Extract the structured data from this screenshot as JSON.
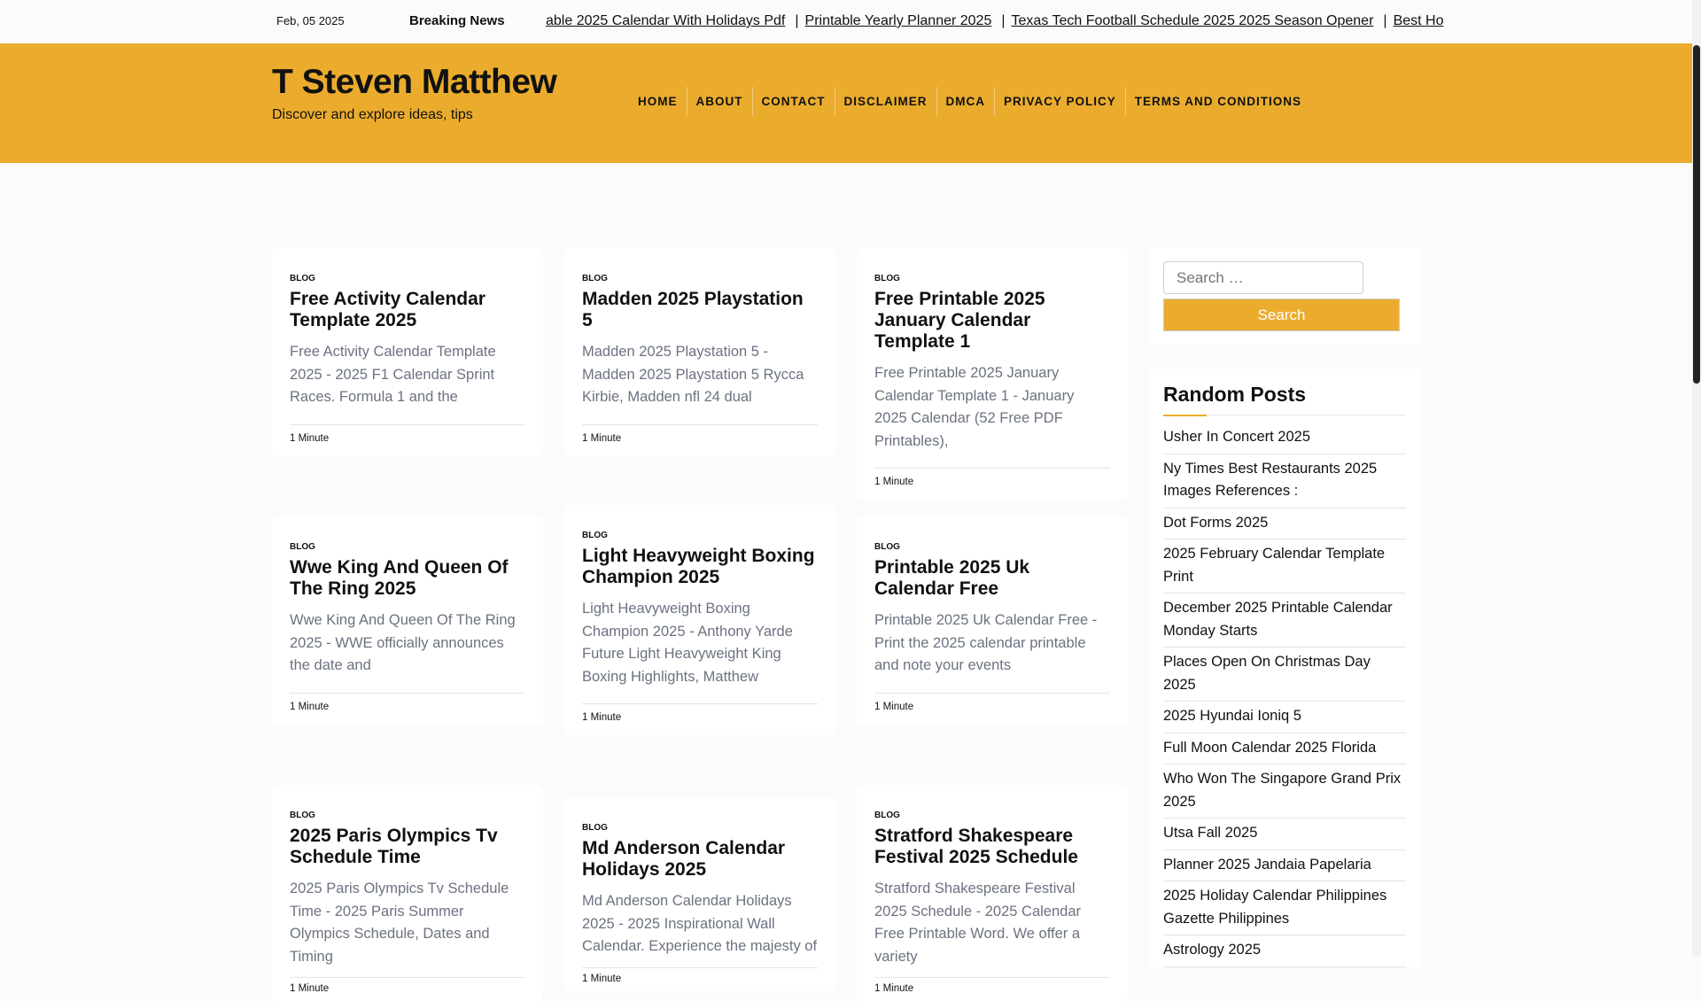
{
  "topbar": {
    "date": "Feb, 05 2025",
    "breaking_label": "Breaking News",
    "ticker": [
      "able 2025 Calendar With Holidays Pdf",
      "Printable Yearly Planner 2025",
      "Texas Tech Football Schedule 2025 2025 Season Opener",
      "Best Ho"
    ]
  },
  "header": {
    "title": "T Steven Matthew",
    "tagline": "Discover and explore ideas, tips",
    "nav": [
      "HOME",
      "ABOUT",
      "CONTACT",
      "DISCLAIMER",
      "DMCA",
      "PRIVACY POLICY",
      "TERMS AND CONDITIONS"
    ]
  },
  "posts": [
    {
      "category": "BLOG",
      "title": "Free Activity Calendar Template 2025",
      "excerpt": "Free Activity Calendar Template 2025 - 2025 F1 Calendar Sprint Races. Formula 1 and the",
      "meta": "1 Minute"
    },
    {
      "category": "BLOG",
      "title": "Madden 2025 Playstation 5",
      "excerpt": "Madden 2025 Playstation 5 - Madden 2025 Playstation 5 Rycca Kirbie, Madden nfl 24 dual",
      "meta": "1 Minute"
    },
    {
      "category": "BLOG",
      "title": "Free Printable 2025 January Calendar Template 1",
      "excerpt": "Free Printable 2025 January Calendar Template 1 - January 2025 Calendar (52 Free PDF Printables),",
      "meta": "1 Minute"
    },
    {
      "category": "BLOG",
      "title": "Wwe King And Queen Of The Ring 2025",
      "excerpt": "Wwe King And Queen Of The Ring 2025 - WWE officially announces the date and",
      "meta": "1 Minute"
    },
    {
      "category": "BLOG",
      "title": "Light Heavyweight Boxing Champion 2025",
      "excerpt": "Light Heavyweight Boxing Champion 2025 - Anthony Yarde Future Light Heavyweight King Boxing Highlights, Matthew",
      "meta": "1 Minute"
    },
    {
      "category": "BLOG",
      "title": "Printable 2025 Uk Calendar Free",
      "excerpt": "Printable 2025 Uk Calendar Free - Print the 2025 calendar printable and note your events",
      "meta": "1 Minute"
    },
    {
      "category": "BLOG",
      "title": "2025 Paris Olympics Tv Schedule Time",
      "excerpt": "2025 Paris Olympics Tv Schedule Time - 2025 Paris Summer Olympics Schedule, Dates and Timing",
      "meta": "1 Minute"
    },
    {
      "category": "BLOG",
      "title": "Md Anderson Calendar Holidays 2025",
      "excerpt": "Md Anderson Calendar Holidays 2025 - 2025 Inspirational Wall Calendar. Experience the majesty of",
      "meta": "1 Minute"
    },
    {
      "category": "BLOG",
      "title": "Stratford Shakespeare Festival 2025 Schedule",
      "excerpt": "Stratford Shakespeare Festival 2025 Schedule - 2025 Calendar Free Printable Word. We offer a variety",
      "meta": "1 Minute"
    }
  ],
  "sidebar": {
    "search_placeholder": "Search …",
    "search_button": "Search",
    "random_title": "Random Posts",
    "random": [
      "Usher In Concert 2025",
      "Ny Times Best Restaurants 2025 Images References :",
      "Dot Forms 2025",
      "2025 February Calendar Template Print",
      "December 2025 Printable Calendar Monday Starts",
      "Places Open On Christmas Day 2025",
      "2025 Hyundai Ioniq 5",
      "Full Moon Calendar 2025 Florida",
      "Who Won The Singapore Grand Prix 2025",
      "Utsa Fall 2025",
      "Planner 2025 Jandaia Papelaria",
      "2025 Holiday Calendar Philippines Gazette Philippines",
      "Astrology 2025"
    ]
  },
  "colors": {
    "accent": "#ebac2e"
  }
}
